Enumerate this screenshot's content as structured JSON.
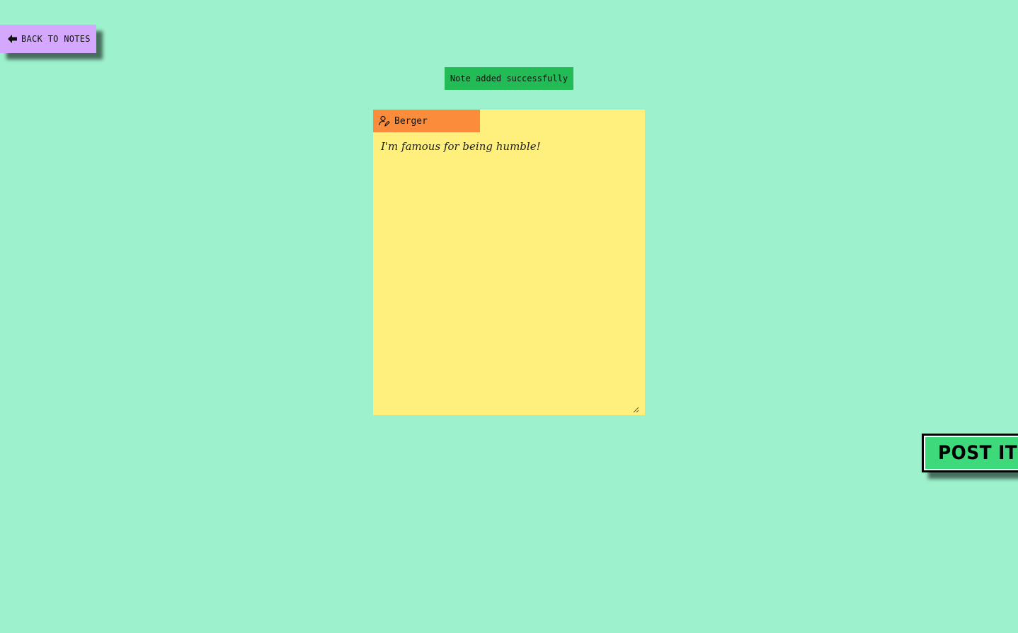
{
  "nav": {
    "back_label": "BACK TO NOTES"
  },
  "toast": {
    "message": "Note added successfully"
  },
  "note": {
    "author": "Berger",
    "text": "I'm famous for being humble!"
  },
  "actions": {
    "post_label": "POST IT"
  },
  "colors": {
    "background": "#9df1cc",
    "back_button": "#d4a8ff",
    "toast": "#22bb55",
    "note": "#fff07e",
    "author_tag": "#fb8c3b",
    "post_button": "#3ed97b"
  },
  "icons": {
    "back": "arrow-left-icon",
    "author": "user-edit-icon",
    "resize": "resize-grip-icon"
  }
}
